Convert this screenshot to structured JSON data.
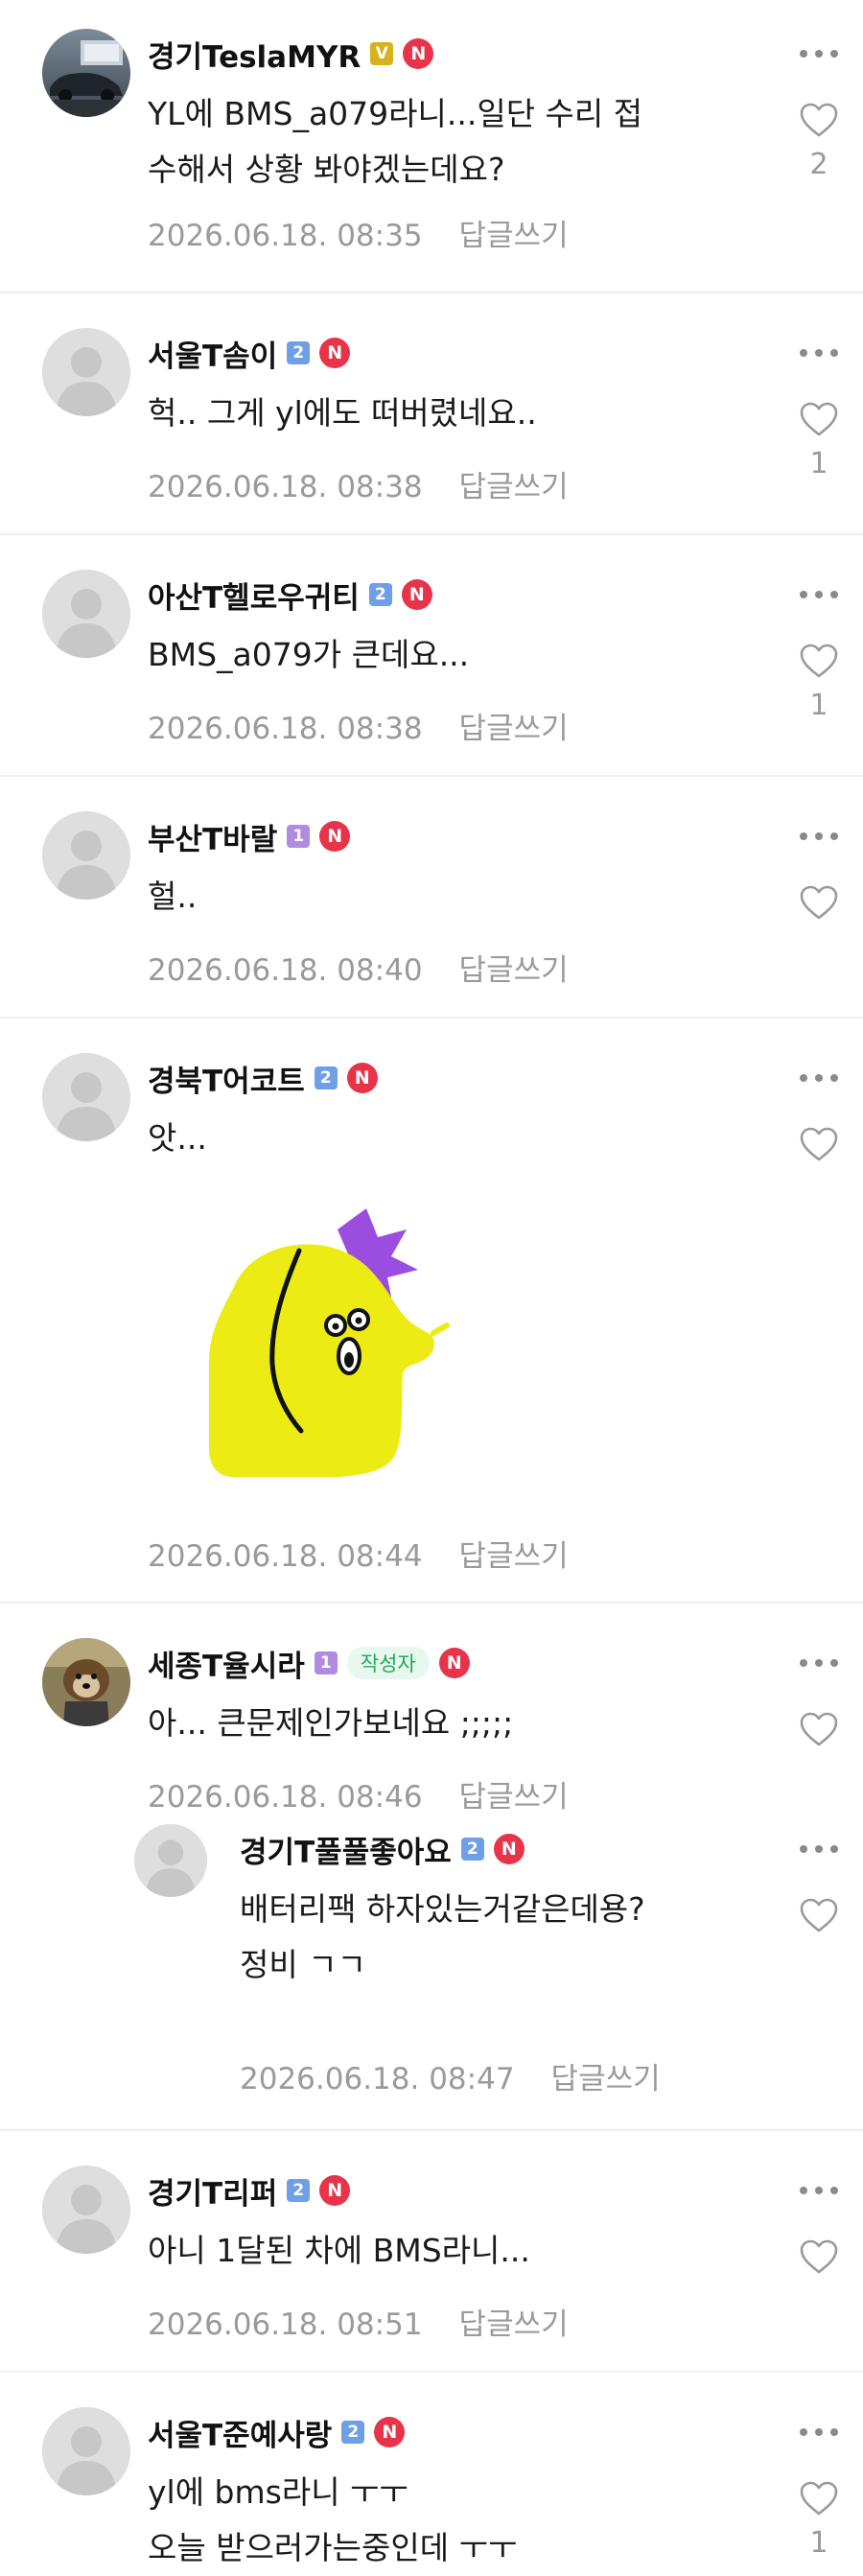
{
  "comments": [
    {
      "nickname": "경기TeslaMYR",
      "level": "V",
      "level_color": "#d8b21c",
      "avatar_type": "photo-car",
      "text": "YL에 BMS_a079라니...일단 수리 접\n수해서 상황 봐야겠는데요?",
      "datetime": "2026.06.18. 08:35",
      "reply_label": "답글쓰기",
      "likes": "2"
    },
    {
      "nickname": "서울T솜이",
      "level": "2",
      "level_color": "#6f9fe6",
      "avatar_type": "default",
      "text": "헉.. 그게 yl에도 떠버렸네요..",
      "datetime": "2026.06.18. 08:38",
      "reply_label": "답글쓰기",
      "likes": "1"
    },
    {
      "nickname": "아산T헬로우귀티",
      "level": "2",
      "level_color": "#6f9fe6",
      "avatar_type": "default",
      "text": "BMS_a079가 큰데요...",
      "datetime": "2026.06.18. 08:38",
      "reply_label": "답글쓰기",
      "likes": "1"
    },
    {
      "nickname": "부산T바랄",
      "level": "1",
      "level_color": "#b08be0",
      "avatar_type": "default",
      "text": "헐..",
      "datetime": "2026.06.18. 08:40",
      "reply_label": "답글쓰기",
      "likes": ""
    },
    {
      "nickname": "경북T어코트",
      "level": "2",
      "level_color": "#6f9fe6",
      "avatar_type": "default",
      "text": "앗...",
      "datetime": "2026.06.18. 08:44",
      "reply_label": "답글쓰기",
      "likes": "",
      "sticker": "yellow-blob-sticker"
    },
    {
      "nickname": "세종T율시라",
      "level": "1",
      "level_color": "#b08be0",
      "avatar_type": "photo-dog",
      "author_tag": "작성자",
      "text": "아... 큰문제인가보네요 ;;;;;",
      "datetime": "2026.06.18. 08:46",
      "reply_label": "답글쓰기",
      "likes": ""
    },
    {
      "nickname": "경기T풀풀좋아요",
      "level": "2",
      "level_color": "#6f9fe6",
      "avatar_type": "default",
      "is_reply": true,
      "text": "배터리팩 하자있는거같은데용?\n정비 ㄱㄱ",
      "datetime": "2026.06.18. 08:47",
      "reply_label": "답글쓰기",
      "likes": ""
    },
    {
      "nickname": "경기T리퍼",
      "level": "2",
      "level_color": "#6f9fe6",
      "avatar_type": "default",
      "text": "아니 1달된 차에 BMS라니...",
      "datetime": "2026.06.18. 08:51",
      "reply_label": "답글쓰기",
      "likes": ""
    },
    {
      "nickname": "서울T준예사랑",
      "level": "2",
      "level_color": "#6f9fe6",
      "avatar_type": "default",
      "text": "yl에 bms라니 ㅜㅜ\n오늘 받으러가는중인데 ㅜㅜ",
      "datetime": "",
      "reply_label": "",
      "likes": "1"
    }
  ],
  "icons": {
    "more": "more-dots-icon",
    "like": "heart-outline-icon",
    "new_badge": "N"
  },
  "colors": {
    "new_badge": "#e8344a",
    "meta_text": "#9a9a9a",
    "author_tag_bg": "#e7f8ee",
    "author_tag_text": "#1fab5a"
  }
}
